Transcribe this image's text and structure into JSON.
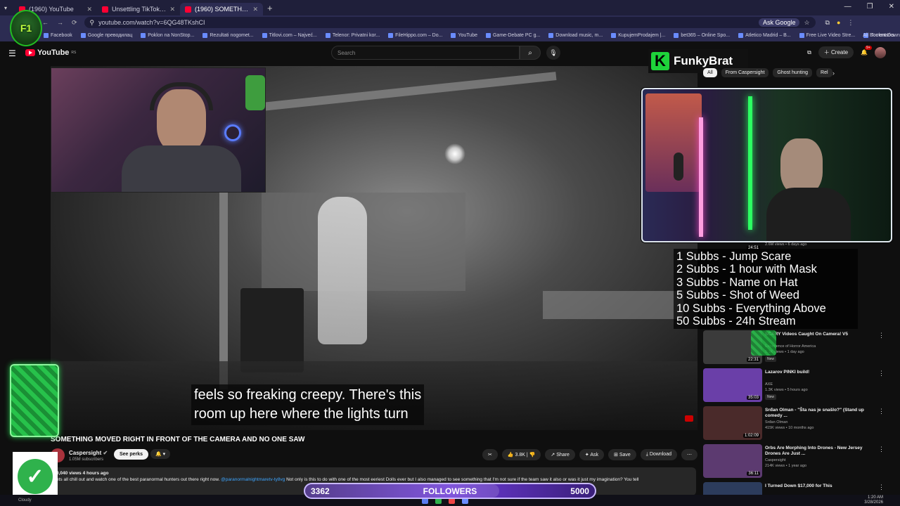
{
  "browser": {
    "tabs": [
      {
        "label": "(1960) YouTube",
        "active": false
      },
      {
        "label": "Unsettling TikToks No One Has",
        "active": false
      },
      {
        "label": "(1960) SOMETHING MOVED",
        "active": true
      }
    ],
    "url": "youtube.com/watch?v=6QG48TKshCI",
    "ask_google": "Ask Google",
    "bookmarks": [
      "Facebook",
      "Google преводилац",
      "Poklon na NonStop...",
      "Rezultati nogomet...",
      "Titlovi.com – Najveć...",
      "Telenor: Privatni kor...",
      "FileHippo.com – Do...",
      "YouTube",
      "Game-Debate PC g...",
      "Download music, m...",
      "KupujemProdajem |...",
      "bet365 – Online Spo...",
      "Atletico Madrid – B...",
      "Free Live Video Stre...",
      "Torrent Downloads..."
    ],
    "all_bookmarks": "All Bookmarks"
  },
  "youtube": {
    "logo_text": "YouTube",
    "logo_region": "RS",
    "search_placeholder": "Search",
    "create_label": "Create",
    "notif_count": "9+"
  },
  "overlay": {
    "logo_text": "F1 KICKSTER",
    "funkybrat_letter": "K",
    "funkybrat_name": "FunkyBrat",
    "sub_goals": [
      "1 Subbs - Jump Scare",
      "2 Subbs - 1 hour with Mask",
      "3 Subbs - Name on Hat",
      "5 Subbs - Shot of Weed",
      "10 Subbs - Everything Above",
      "50 Subbs - 24h Stream"
    ],
    "followers_current": "3362",
    "followers_label": "FOLLOWERS",
    "followers_goal": "5000",
    "followers_progress": 0.67
  },
  "video": {
    "subtitle_line1": "feels so freaking creepy. There's this",
    "subtitle_line2": "room up here where the lights turn",
    "title": "SOMETHING MOVED RIGHT IN FRONT OF THE CAMERA AND NO ONE SAW",
    "channel_name": "Caspersight",
    "channel_subs": "1.05M subscribers",
    "see_perks": "See perks",
    "like_count": "3.8K",
    "share": "Share",
    "ask": "Ask",
    "save": "Save",
    "download": "Download",
    "desc_meta": "0,040 views  4 hours ago",
    "desc_text_a": "ets all chill out and watch one of the best paranormal hunters out there right now.",
    "desc_link": "@paranormalnightmaretv-ty8vg",
    "desc_text_b": "Not only is this to do with one of the most eeriest Dolls ever but I also managed to see something that I'm not sure if the team saw it also or was it just my imagination? You tell"
  },
  "chips": [
    "All",
    "From Caspersight",
    "Ghost hunting",
    "Rel"
  ],
  "recommendations": [
    {
      "title": "SCARY Videos Caught On Camera! V5",
      "channel": "Experience of Horror America",
      "meta": "5.1K views • 1 day ago",
      "duration": "22:31",
      "new": "New",
      "thumb": "#3b3b3b"
    },
    {
      "title": "Lazarov PINKI build!",
      "channel": "AXE",
      "meta": "1.3K views • 5 hours ago",
      "duration": "35:03",
      "new": "New",
      "thumb": "#6a3fa8"
    },
    {
      "title": "Srđan Olman - \"Šta nas je snašlo?\" (Stand up comedy ...",
      "channel": "Srđan Olman",
      "meta": "415K views • 10 months ago",
      "duration": "1:02:09",
      "new": "",
      "thumb": "#4a2a2a"
    },
    {
      "title": "Orbs Are Morphing Into Drones - New Jersey Drones Are Just ...",
      "channel": "Caspersight",
      "meta": "214K views • 1 year ago",
      "duration": "36:11",
      "new": "",
      "thumb": "#5c3a70"
    },
    {
      "title": "I Turned Down $17,000 for This",
      "channel": "Forever Funhouse",
      "meta": "",
      "duration": "",
      "new": "",
      "thumb": "#2c3c5c"
    }
  ],
  "partial_rec": {
    "meta": "2.6M views • 6 days ago",
    "duration": "24:51"
  },
  "taskbar": {
    "weather": "Cloudy",
    "time": "1:20 AM",
    "date": "3/28/2026"
  },
  "colors": {
    "yt_red": "#ff0033",
    "funky_green": "#1ed33a",
    "follow_purple": "#6c3ad6"
  }
}
